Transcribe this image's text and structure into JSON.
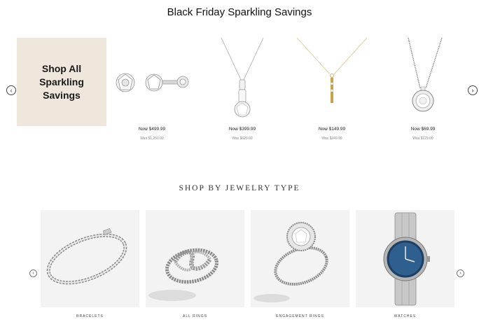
{
  "promo": {
    "title": "Black Friday Sparkling Savings",
    "shop_all_label": "Shop All Sparkling Savings",
    "prev_icon": "chevron-left-icon",
    "next_icon": "chevron-right-icon",
    "products": [
      {
        "now": "Now $499.99",
        "was": "Was $1,250.00",
        "icon": "stud-earrings"
      },
      {
        "now": "Now $399.99",
        "was": "Was $629.00",
        "icon": "solitaire-pendant-necklace"
      },
      {
        "now": "Now $149.99",
        "was": "Was $249.99",
        "icon": "gold-bar-pendant-necklace"
      },
      {
        "now": "Now $69.99",
        "was": "Was $129.00",
        "icon": "halo-pendant-necklace"
      }
    ]
  },
  "jewelry_types": {
    "title": "SHOP BY JEWELRY TYPE",
    "categories": [
      {
        "label": "BRACELETS",
        "icon": "tennis-bracelet"
      },
      {
        "label": "ALL RINGS",
        "icon": "infinity-ring"
      },
      {
        "label": "ENGAGEMENT RINGS",
        "icon": "halo-engagement-ring"
      },
      {
        "label": "WATCHES",
        "icon": "blue-dial-watch"
      }
    ]
  },
  "colors": {
    "promo_tile_bg": "#efe7dc",
    "category_tile_bg": "#f3f3f3",
    "watch_dial": "#2f5f8f",
    "gold": "#c9a24b"
  }
}
